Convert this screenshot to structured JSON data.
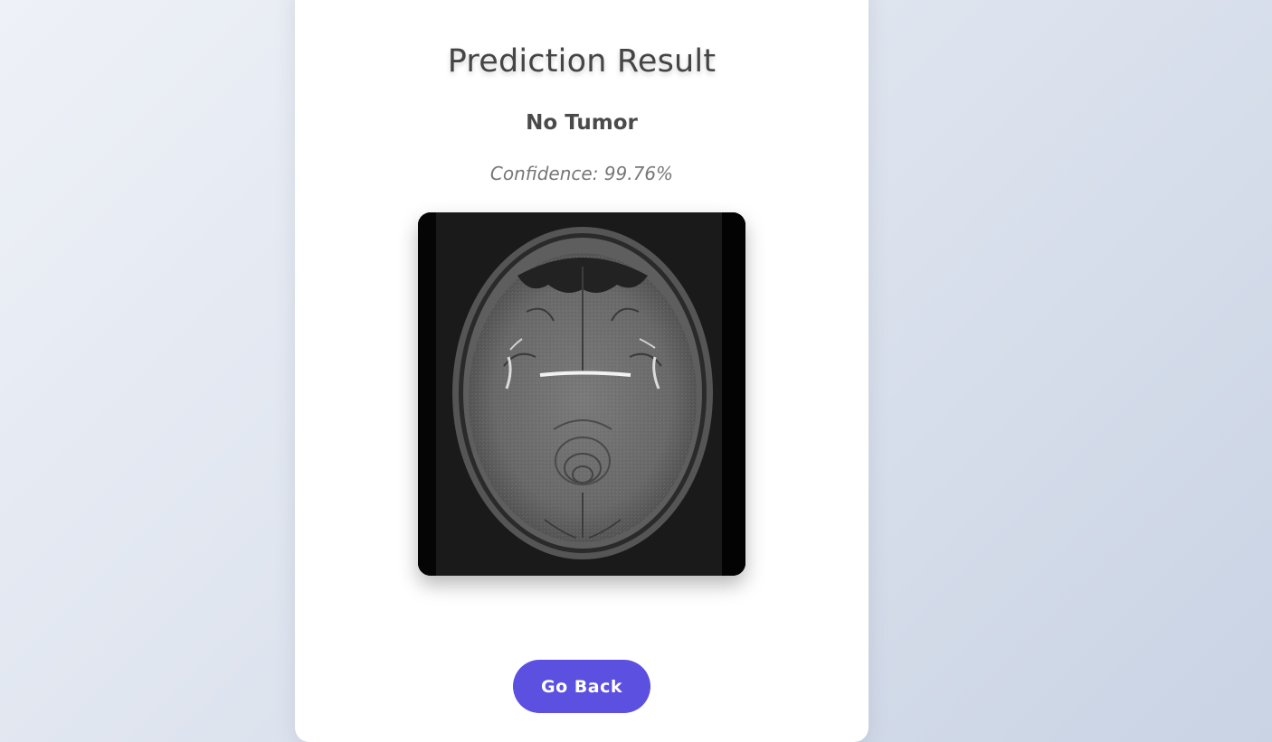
{
  "page": {
    "title": "Prediction Result",
    "prediction": "No Tumor",
    "confidence_text": "Confidence: 99.76%"
  },
  "image": {
    "alt": "Axial brain MRI scan"
  },
  "actions": {
    "go_back_label": "Go Back"
  },
  "colors": {
    "accent": "#5b50e0",
    "title_text": "#454545",
    "muted_text": "#777777"
  }
}
